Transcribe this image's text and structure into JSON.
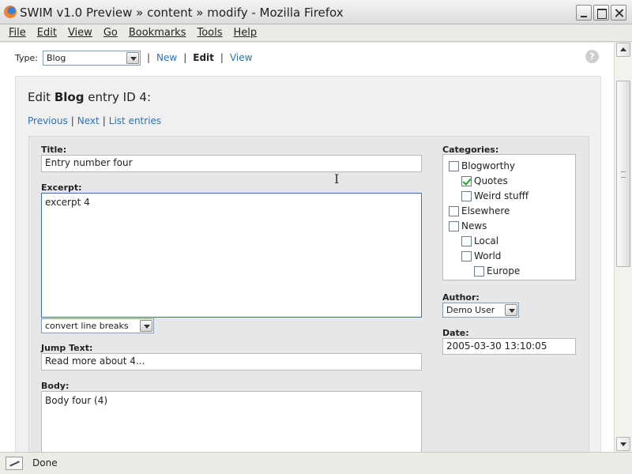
{
  "window": {
    "title": "SWIM v1.0 Preview » content » modify - Mozilla Firefox"
  },
  "menu": [
    "File",
    "Edit",
    "View",
    "Go",
    "Bookmarks",
    "Tools",
    "Help"
  ],
  "typebar": {
    "label": "Type:",
    "selected_type": "Blog",
    "links": {
      "new": "New",
      "edit": "Edit",
      "view": "View"
    },
    "separator": "|",
    "help": "?"
  },
  "page": {
    "heading_prefix": "Edit",
    "heading_type": "Blog",
    "heading_suffix": "entry ID 4:",
    "nav": {
      "previous": "Previous",
      "next": "Next",
      "list": "List entries",
      "separator": "|"
    }
  },
  "form": {
    "title_label": "Title:",
    "title_value": "Entry number four",
    "excerpt_label": "Excerpt:",
    "excerpt_value": "excerpt 4",
    "format_value": "convert line breaks",
    "jump_label": "Jump Text:",
    "jump_value": "Read more about 4...",
    "body_label": "Body:",
    "body_value": "Body four (4)",
    "categories_label": "Categories:",
    "categories": [
      {
        "label": "Blogworthy",
        "checked": false
      },
      {
        "label": "Quotes",
        "checked": true
      },
      {
        "label": "Weird stufff",
        "checked": false
      },
      {
        "label": "Elsewhere",
        "checked": false
      },
      {
        "label": "News",
        "checked": false
      },
      {
        "label": "Local",
        "checked": false
      },
      {
        "label": "World",
        "checked": false
      },
      {
        "label": "Europe",
        "checked": false
      }
    ],
    "author_label": "Author:",
    "author_value": "Demo User",
    "date_label": "Date:",
    "date_value": "2005-03-30 13:10:05"
  },
  "status": {
    "text": "Done"
  },
  "colors": {
    "link": "#2a72b5",
    "focus_border": "#3d6fb0",
    "check": "#21a121"
  }
}
